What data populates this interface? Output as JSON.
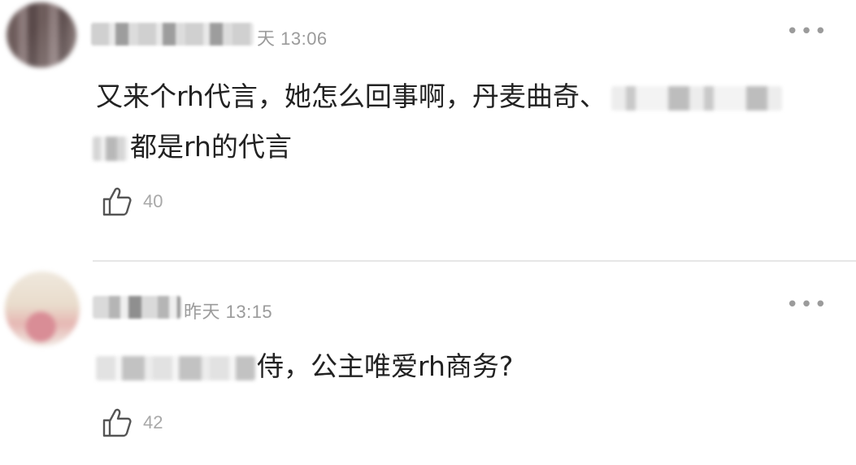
{
  "comments": [
    {
      "meta": "天 13:06",
      "text_line1_before": "又来个rh代言，她怎么回事啊，丹麦曲奇、",
      "text_line2_after": "都是rh的代言",
      "likes": "40",
      "more_icon": "more-dots-icon",
      "like_icon": "thumbs-up-icon"
    },
    {
      "meta": "昨天 13:15",
      "text_line1_after": "侍，公主唯爱rh商务?",
      "likes": "42",
      "more_icon": "more-dots-icon",
      "like_icon": "thumbs-up-icon"
    }
  ],
  "colors": {
    "text": "#222222",
    "meta": "#9b9b9b",
    "like_count": "#a8a8a8",
    "divider": "#e6e6e6"
  }
}
